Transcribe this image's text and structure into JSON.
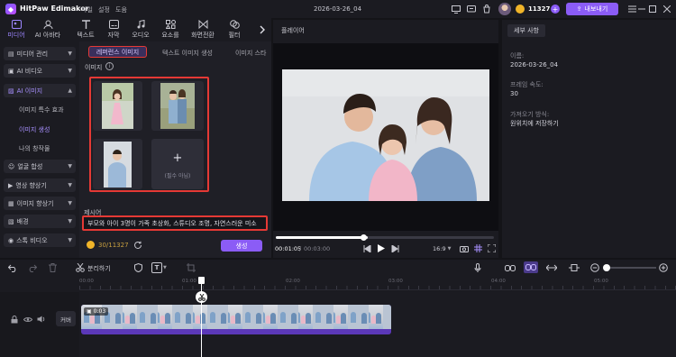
{
  "app": {
    "name": "HitPaw Edimakor",
    "menu": [
      "파일",
      "설정",
      "도움"
    ],
    "project_title": "2026-03-26_04",
    "credits": "11327",
    "export_label": "내보내기"
  },
  "tools": [
    {
      "label": "미디어",
      "icon": "media-icon"
    },
    {
      "label": "AI 아바타",
      "icon": "ai-avatar-icon"
    },
    {
      "label": "텍스트",
      "icon": "text-icon"
    },
    {
      "label": "자막",
      "icon": "subtitle-icon"
    },
    {
      "label": "오디오",
      "icon": "audio-icon"
    },
    {
      "label": "요소를",
      "icon": "elements-icon"
    },
    {
      "label": "화면전환",
      "icon": "transition-icon"
    },
    {
      "label": "필터",
      "icon": "filter-icon"
    }
  ],
  "sidebar": {
    "categories": [
      "미디어 관리",
      "AI 비디오",
      "AI 이미지",
      "얼굴 합성",
      "영상 향상기",
      "이미지 향상기",
      "배경",
      "스톡 비디오"
    ],
    "sub_items": [
      "이미지 특수 효과",
      "이미지 생성",
      "나의 창작물"
    ]
  },
  "panel": {
    "tabs": [
      "레퍼런스 이미지",
      "텍스트 이미지 생성",
      "이미지 스타"
    ],
    "image_label": "이미지",
    "add_label": "(필수 아님)",
    "prompt_label": "제시어",
    "prompt_text": "부모와 아이 3명이 가족 초상화, 스튜디오 조명, 자연스러운 미소",
    "credit_cost": "30/11327",
    "generate_label": "생성"
  },
  "preview": {
    "title": "플레이어",
    "current_time": "00:01:05",
    "total_time": "00:03:00",
    "aspect": "16:9",
    "progress": 0.42
  },
  "details": {
    "tab": "세부 사항",
    "name_label": "이름:",
    "name_value": "2026-03-26_04",
    "fps_label": "프레임 속도:",
    "fps_value": "30",
    "save_label": "가져오기 방식:",
    "save_value": "원위치에 저장하기"
  },
  "timeline": {
    "split_label": "분리하기",
    "ticks": [
      "00:00",
      "01:00",
      "02:00",
      "03:00",
      "04:00",
      "05:00"
    ],
    "clip_duration": "0:03",
    "track_label": "커버"
  },
  "colors": {
    "accent": "#8b5cf6",
    "highlight": "#e53935",
    "clip": "#6a3fc8"
  }
}
